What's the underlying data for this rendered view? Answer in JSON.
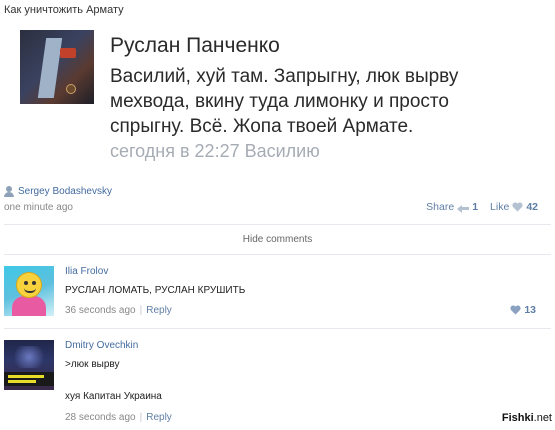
{
  "page": {
    "title": "Как уничтожить Армату"
  },
  "embedded_comment": {
    "author": "Руслан Панченко",
    "text": "Василий, хуй там. Запрыгну, люк вырву мехвода, вкину туда лимонку и просто спрыгну. Всё. Жопа твоей Армате.",
    "time": "сегодня в 22:27 Василию"
  },
  "post": {
    "author": "Sergey Bodashevsky",
    "time": "one minute ago",
    "share_label": "Share",
    "share_count": "1",
    "like_label": "Like",
    "like_count": "42",
    "hide_comments": "Hide comments"
  },
  "replies": [
    {
      "author": "Ilia Frolov",
      "lines": [
        "РУСЛАН ЛОМАТЬ, РУСЛАН КРУШИТЬ"
      ],
      "time": "36 seconds ago",
      "reply_label": "Reply",
      "likes": "13"
    },
    {
      "author": "Dmitry Ovechkin",
      "lines": [
        ">люк вырву",
        "хуя Капитан Украина"
      ],
      "time": "28 seconds ago",
      "reply_label": "Reply"
    }
  ],
  "watermark": {
    "brand": "Fishki",
    "suffix": ".net"
  },
  "colors": {
    "link": "#436b9e",
    "action": "#5f7ea5",
    "muted": "#888888",
    "embed_time": "#a6acb4"
  }
}
